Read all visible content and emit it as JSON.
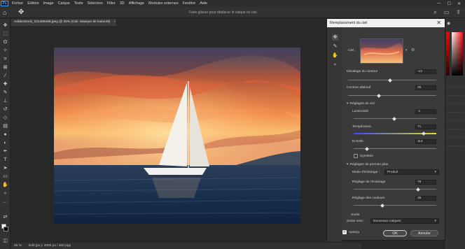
{
  "menubar": {
    "items": [
      "Fichier",
      "Edition",
      "Image",
      "Calque",
      "Texte",
      "Sélection",
      "Filtre",
      "3D",
      "Affichage",
      "Modules externes",
      "Fenêtre",
      "Aide"
    ],
    "logo_text": "Ps",
    "minimize": "—",
    "maximize": "☐",
    "close": "✕"
  },
  "optionsbar": {
    "hint": "Faire glisser pour déplacer le calque du ciel."
  },
  "document": {
    "tab_title": "AdobeStock_331465466.jpeg @ 25% (Ciel, Masque de fusion/8)",
    "tab_close": "×"
  },
  "status": {
    "zoom": "25 %",
    "info": "Edit (px.): 3000 px / 300 ppp"
  },
  "dialog": {
    "title": "Remplacement du ciel",
    "close": "✕",
    "sky_label": "Ciel :",
    "shift_edge": {
      "label": "Décalage du contour",
      "value": "-13",
      "level": 0.48
    },
    "fade_edge": {
      "label": "Contour atténué",
      "value": "35",
      "level": 0.35
    },
    "sky_adjust": {
      "header": "Réglages du ciel",
      "brightness": {
        "label": "Luminosité",
        "value": "-1",
        "level": 0.49
      },
      "temperature": {
        "label": "Température",
        "value": "71",
        "level": 0.85
      },
      "scale": {
        "label": "Echelle",
        "value": "114",
        "level": 0.16
      },
      "flip": {
        "label": "Symétrie",
        "checked": false
      }
    },
    "foreground": {
      "header": "Réglages de premier plan",
      "mode_label": "Mode d'éclairage :",
      "mode_value": "Produit",
      "lighting": {
        "label": "Réglage de l'éclairage",
        "value": "78",
        "level": 0.78
      },
      "color": {
        "label": "Réglage des couleurs",
        "value": "35",
        "level": 0.35
      }
    },
    "output": {
      "header": "Sortie",
      "label": "Sortie vers :",
      "value": "Nouveaux calques"
    },
    "preview": {
      "label": "Aperçu",
      "checked": true
    },
    "ok_label": "OK",
    "cancel_label": "Annuler"
  },
  "colors": {
    "accent": "#31a8ff",
    "panel": "#3a3a3a",
    "titlebar": "#f0f0f0"
  },
  "icons": [
    "move-icon",
    "marquee-icon",
    "lasso-icon",
    "magic-wand-icon",
    "crop-icon",
    "eyedropper-icon",
    "brush-icon",
    "stamp-icon",
    "eraser-icon",
    "gradient-icon",
    "pen-icon",
    "type-icon",
    "hand-icon",
    "zoom-icon",
    "sky-brush-icon",
    "search-icon",
    "share-icon"
  ]
}
